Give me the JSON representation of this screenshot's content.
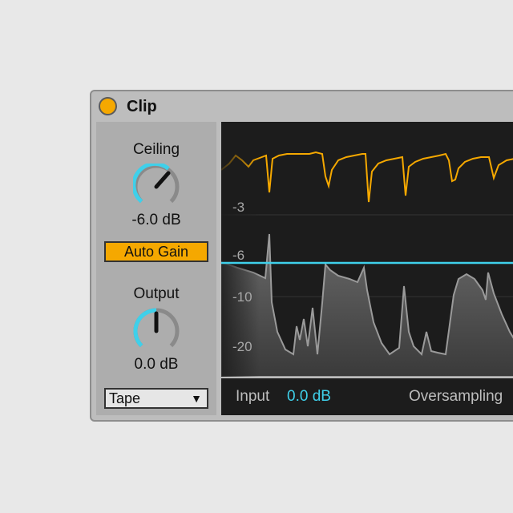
{
  "device": {
    "title": "Clip"
  },
  "controls": {
    "ceiling_label": "Ceiling",
    "ceiling_value": "-6.0 dB",
    "auto_gain_label": "Auto Gain",
    "output_label": "Output",
    "output_value": "0.0 dB",
    "mode_selected": "Tape",
    "dropdown_arrow": "▼"
  },
  "display": {
    "scale_labels": [
      "-3",
      "-6",
      "-10",
      "-20"
    ],
    "ceiling_line_db": -6
  },
  "bottom_bar": {
    "input_label": "Input",
    "input_value": "0.0 dB",
    "oversampling_label": "Oversampling"
  },
  "colors": {
    "accent_orange": "#f5a800",
    "accent_cyan": "#3fd0ea",
    "panel_gray": "#bdbdbd",
    "display_bg": "#1c1c1c"
  }
}
